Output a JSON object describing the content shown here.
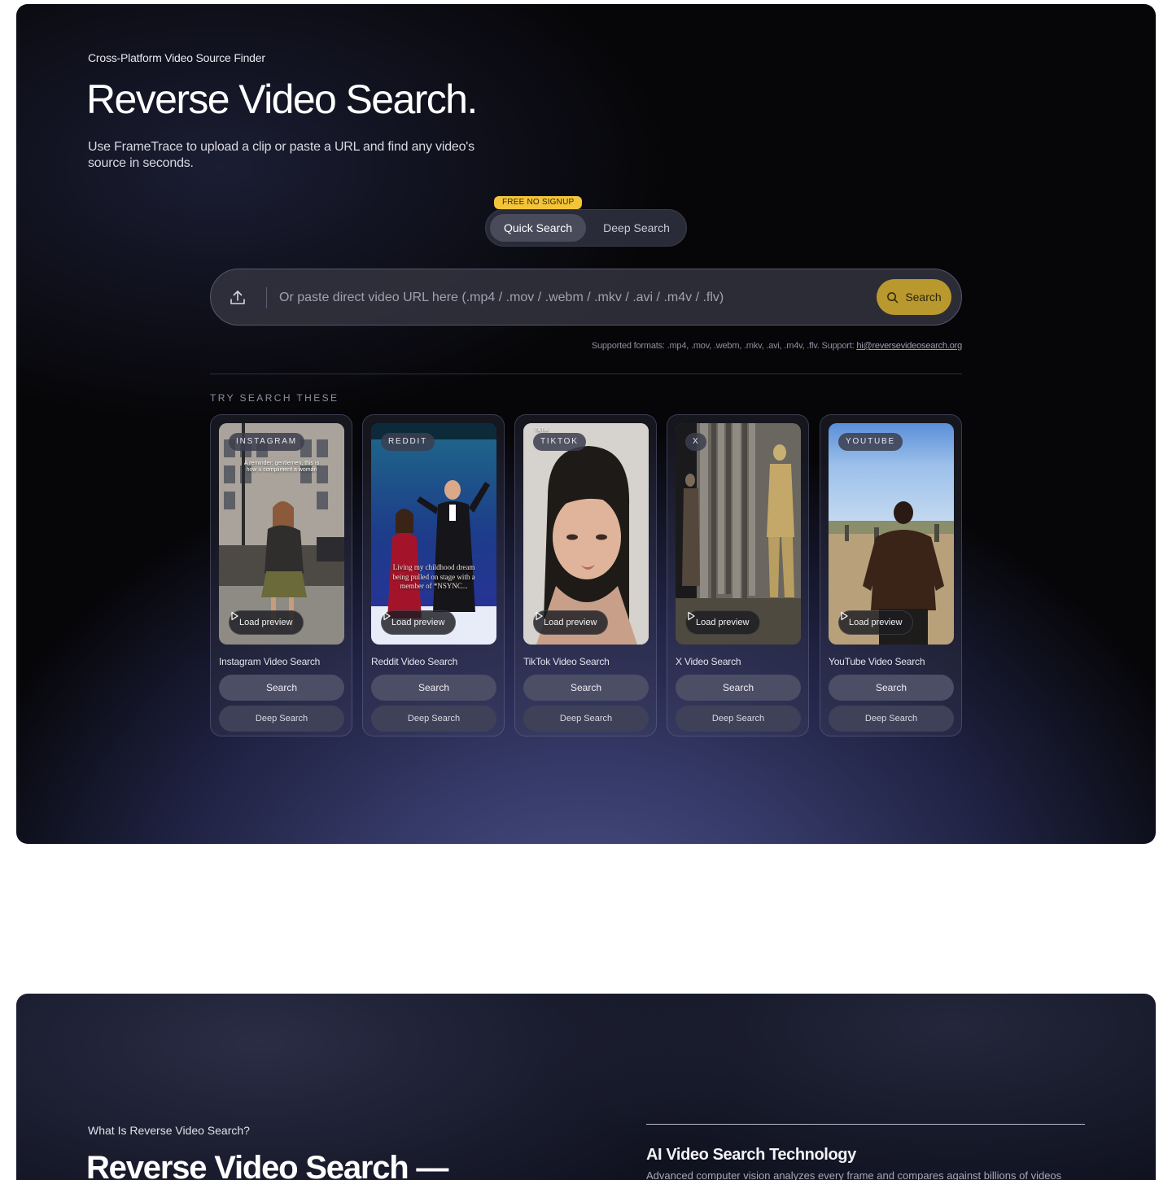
{
  "hero": {
    "eyebrow": "Cross-Platform Video Source Finder",
    "title": "Reverse Video Search.",
    "subtitle": "Use FrameTrace to upload a clip or paste a URL and find any video's source in seconds."
  },
  "mode_toggle": {
    "badge": "FREE NO SIGNUP",
    "quick_label": "Quick Search",
    "deep_label": "Deep Search",
    "selected": "Quick Search"
  },
  "search_bar": {
    "placeholder": "Or paste direct video URL here (.mp4 / .mov / .webm / .mkv / .avi / .m4v / .flv)",
    "value": "",
    "button_label": "Search",
    "upload_icon": "upload-icon",
    "search_icon": "search-icon"
  },
  "formats": {
    "text": "Supported formats: .mp4, .mov, .webm, .mkv, .avi, .m4v, .flv. Support:",
    "email": "hi@reversevideosearch.org"
  },
  "examples": {
    "label": "TRY SEARCH THESE",
    "cards": [
      {
        "platform": "INSTAGRAM",
        "title": "Instagram Video Search",
        "overlay": "A reminder: gentlemen, this is how u compliment a woman",
        "preview": "Load preview",
        "search": "Search",
        "deep": "Deep Search"
      },
      {
        "platform": "REDDIT",
        "title": "Reddit Video Search",
        "overlay": "Living my childhood dream being pulled on stage with a member of *NSYNC...",
        "preview": "Load preview",
        "search": "Search",
        "deep": "Deep Search"
      },
      {
        "platform": "TIKTOK",
        "title": "TikTok Video Search",
        "overlay": "TikTok",
        "preview": "Load preview",
        "search": "Search",
        "deep": "Deep Search"
      },
      {
        "platform": "X",
        "title": "X Video Search",
        "overlay": "",
        "preview": "Load preview",
        "search": "Search",
        "deep": "Deep Search"
      },
      {
        "platform": "YOUTUBE",
        "title": "YouTube Video Search",
        "overlay": "",
        "preview": "Load preview",
        "search": "Search",
        "deep": "Deep Search"
      }
    ]
  },
  "info": {
    "eyebrow": "What Is Reverse Video Search?",
    "title": "Reverse Video Search —",
    "feature_title": "AI Video Search Technology",
    "feature_text": "Advanced computer vision analyzes every frame and compares against billions of videos"
  },
  "colors": {
    "accent_gold": "#b9982e",
    "badge_yellow": "#f3c43a",
    "hero_bg": "#060608"
  }
}
